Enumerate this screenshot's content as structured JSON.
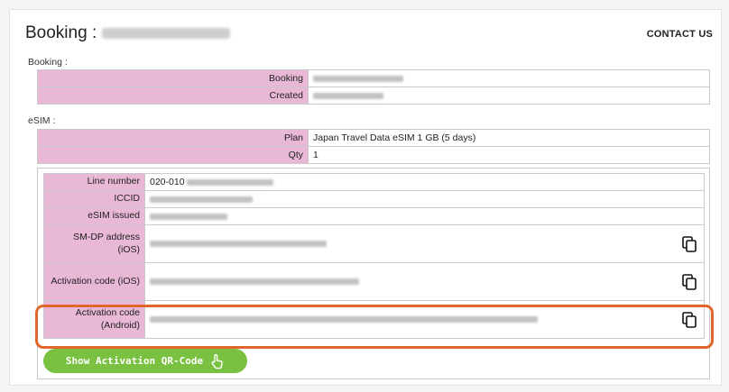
{
  "header": {
    "title": "Booking :",
    "contact_label": "CONTACT US"
  },
  "booking_section": {
    "label": "Booking :",
    "rows": [
      {
        "label": "Booking"
      },
      {
        "label": "Created"
      }
    ]
  },
  "esim_section": {
    "label": "eSIM :",
    "plan_label": "Plan",
    "plan_value": "Japan Travel Data eSIM 1 GB (5 days)",
    "qty_label": "Qty",
    "qty_value": "1"
  },
  "esim_details": {
    "line_number_label": "Line number",
    "line_number_prefix": "020-010",
    "iccid_label": "ICCID",
    "issued_label": "eSIM issued",
    "smdp_label": "SM-DP address (iOS)",
    "activation_ios_label": "Activation code (iOS)",
    "activation_android_label_1": "Activation code",
    "activation_android_label_2": "(Android)"
  },
  "qr_button": {
    "label": "Show Activation QR-Code"
  },
  "icons": {
    "copy": "copy-icon",
    "hand": "pointing-hand-icon"
  },
  "colors": {
    "label_bg": "#e8b8d6",
    "highlight": "#e0662b",
    "button": "#7ac142"
  }
}
